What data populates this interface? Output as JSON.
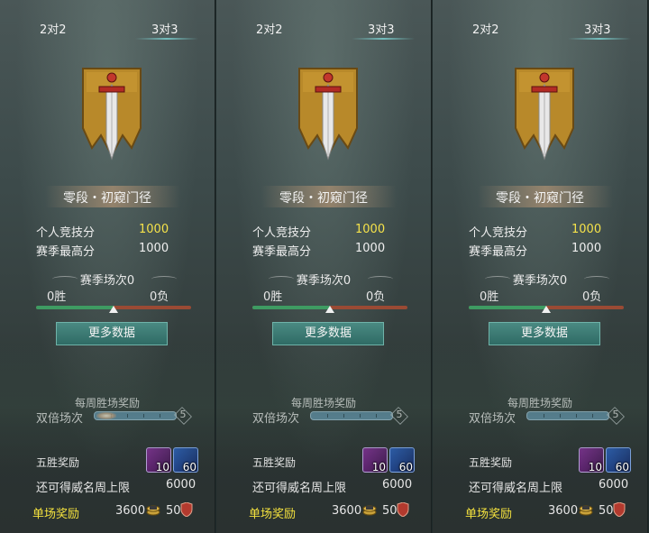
{
  "panels": [
    {
      "tabs": [
        "2对2",
        "3对3"
      ],
      "rank_name": "零段・初窥门径",
      "personal_score_label": "个人竞技分",
      "personal_score": "1000",
      "season_high_label": "赛季最高分",
      "season_high": "1000",
      "season_matches": "赛季场次0",
      "wins": "0胜",
      "losses": "0负",
      "win_ratio": 0.5,
      "more_data_button": "更多数据",
      "weekly_reward_title": "每周胜场奖励",
      "double_label": "双倍场次",
      "double_count": "5",
      "five_win_label": "五胜奖励",
      "reward_items": [
        {
          "icon": "chest-icon",
          "count": "10"
        },
        {
          "icon": "key-icon",
          "count": "60"
        }
      ],
      "fame_cap_label": "还可得威名周上限",
      "fame_cap_value": "6000",
      "single_reward_label": "单场奖励",
      "single_coins": "3600",
      "single_points": "50"
    },
    {
      "tabs": [
        "2对2",
        "3对3"
      ],
      "rank_name": "零段・初窥门径",
      "personal_score_label": "个人竞技分",
      "personal_score": "1000",
      "season_high_label": "赛季最高分",
      "season_high": "1000",
      "season_matches": "赛季场次0",
      "wins": "0胜",
      "losses": "0负",
      "win_ratio": 0.5,
      "more_data_button": "更多数据",
      "weekly_reward_title": "每周胜场奖励",
      "double_label": "双倍场次",
      "double_count": "5",
      "five_win_label": "五胜奖励",
      "reward_items": [
        {
          "icon": "chest-icon",
          "count": "10"
        },
        {
          "icon": "key-icon",
          "count": "60"
        }
      ],
      "fame_cap_label": "还可得威名周上限",
      "fame_cap_value": "6000",
      "single_reward_label": "单场奖励",
      "single_coins": "3600",
      "single_points": "50"
    },
    {
      "tabs": [
        "2对2",
        "3对3"
      ],
      "rank_name": "零段・初窥门径",
      "personal_score_label": "个人竞技分",
      "personal_score": "1000",
      "season_high_label": "赛季最高分",
      "season_high": "1000",
      "season_matches": "赛季场次0",
      "wins": "0胜",
      "losses": "0负",
      "win_ratio": 0.5,
      "more_data_button": "更多数据",
      "weekly_reward_title": "每周胜场奖励",
      "double_label": "双倍场次",
      "double_count": "5",
      "five_win_label": "五胜奖励",
      "reward_items": [
        {
          "icon": "chest-icon",
          "count": "10"
        },
        {
          "icon": "key-icon",
          "count": "60"
        }
      ],
      "fame_cap_label": "还可得威名周上限",
      "fame_cap_value": "6000",
      "single_reward_label": "单场奖励",
      "single_coins": "3600",
      "single_points": "50"
    }
  ],
  "colors": {
    "score_highlight": "#f5e24a",
    "single_reward_label": "#f4e23e",
    "win_bar": "#3e9b62",
    "loss_bar": "#9a4a34",
    "button": "#3a7a73"
  }
}
